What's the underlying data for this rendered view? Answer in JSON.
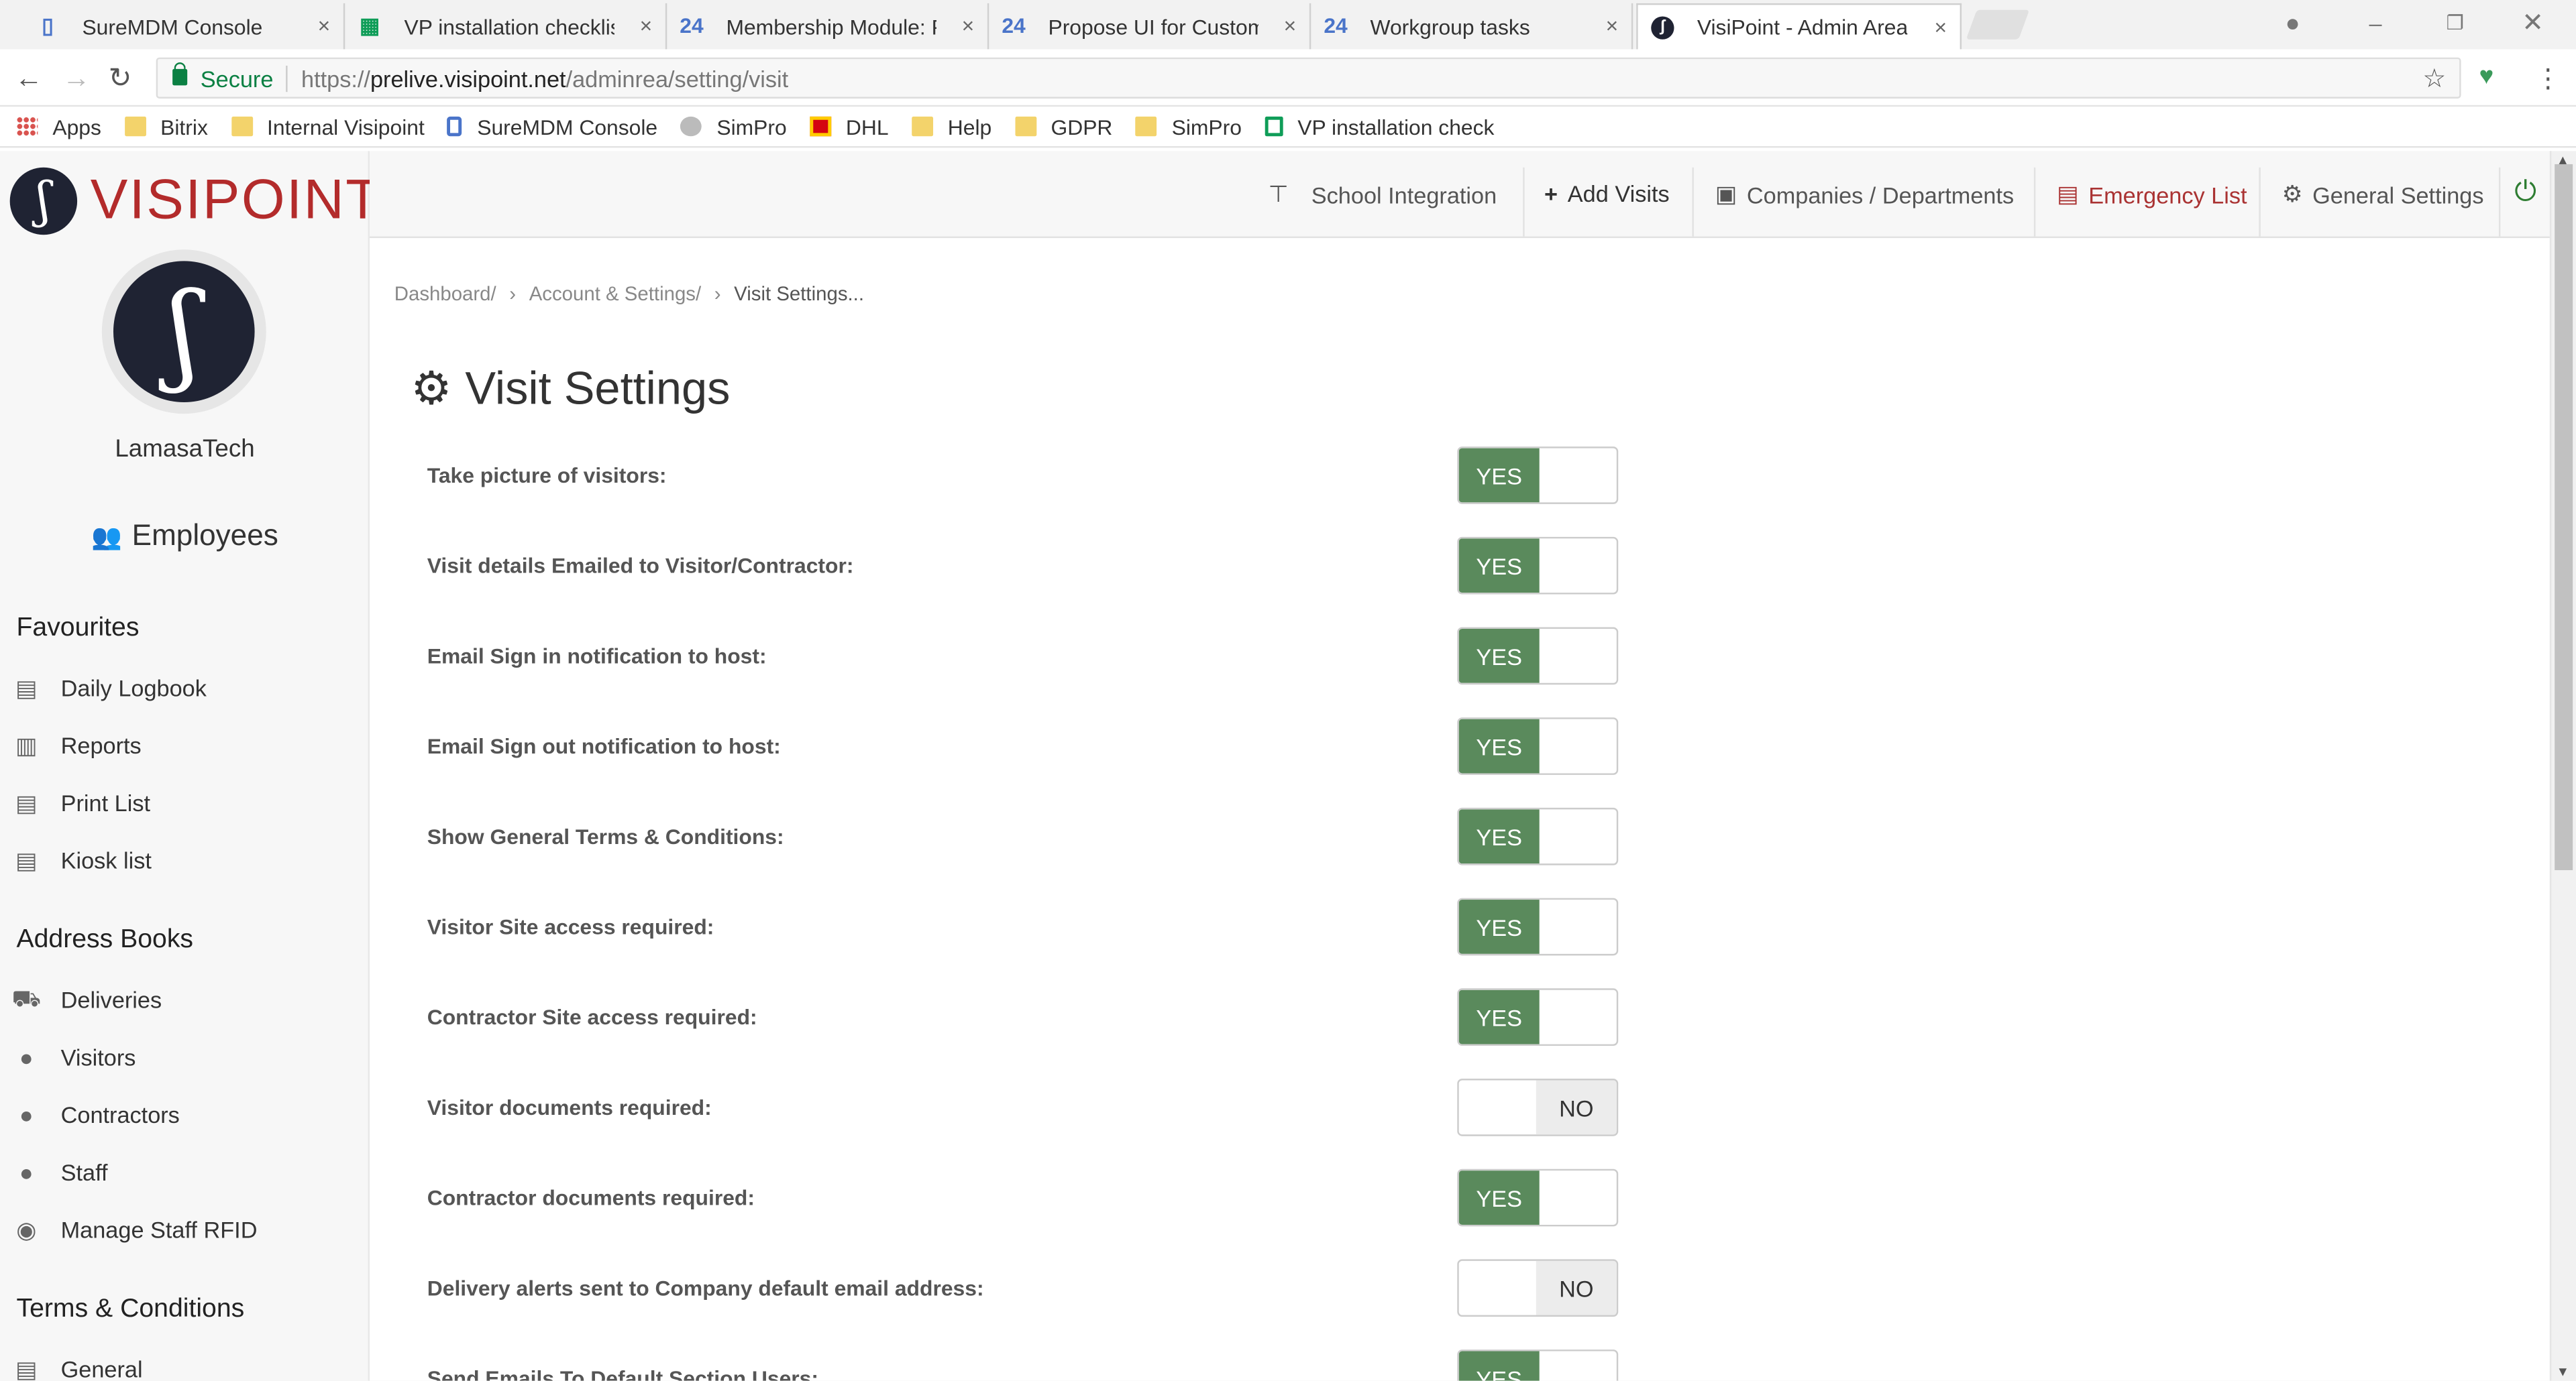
{
  "browser": {
    "tabs": [
      {
        "label": "SureMDM Console",
        "icon": "phone-icon"
      },
      {
        "label": "VP installation checklist -",
        "icon": "sheet-icon"
      },
      {
        "label": "Membership Module: PR",
        "icon": "24"
      },
      {
        "label": "Propose UI for Custom fi",
        "icon": "24"
      },
      {
        "label": "Workgroup tasks",
        "icon": "24"
      },
      {
        "label": "VisiPoint - Admin Area",
        "icon": "visipoint-icon"
      }
    ],
    "close_glyph": "×",
    "address": {
      "secure_label": "Secure",
      "url_scheme": "https://",
      "url_host": "prelive.visipoint.net",
      "url_path": "/adminrea/setting/visit"
    },
    "bookmarks": [
      "Apps",
      "Bitrix",
      "Internal Visipoint",
      "SureMDM Console",
      "SimPro",
      "DHL",
      "Help",
      "GDPR",
      "SimPro",
      "VP installation check"
    ]
  },
  "app": {
    "logo_text": "VISIPOINT",
    "company_name": "LamasaTech",
    "employees_label": "Employees",
    "favourites_heading": "Favourites",
    "favourites": [
      "Daily Logbook",
      "Reports",
      "Print List",
      "Kiosk list"
    ],
    "address_books_heading": "Address Books",
    "address_books": [
      "Deliveries",
      "Visitors",
      "Contractors",
      "Staff",
      "Manage Staff RFID"
    ],
    "terms_heading": "Terms & Conditions",
    "terms": [
      "General"
    ],
    "topnav": [
      "School Integration",
      "Add Visits",
      "Companies / Departments",
      "Emergency List",
      "General Settings"
    ],
    "breadcrumb": [
      "Dashboard/",
      "Account & Settings/",
      "Visit Settings..."
    ],
    "breadcrumb_sep": "›",
    "page_title": "Visit Settings",
    "settings": [
      {
        "label": "Take picture of visitors:",
        "value": "YES"
      },
      {
        "label": "Visit details Emailed to Visitor/Contractor:",
        "value": "YES"
      },
      {
        "label": "Email Sign in notification to host:",
        "value": "YES"
      },
      {
        "label": "Email Sign out notification to host:",
        "value": "YES"
      },
      {
        "label": "Show General Terms & Conditions:",
        "value": "YES"
      },
      {
        "label": "Visitor Site access required:",
        "value": "YES"
      },
      {
        "label": "Contractor Site access required:",
        "value": "YES"
      },
      {
        "label": "Visitor documents required:",
        "value": "NO"
      },
      {
        "label": "Contractor documents required:",
        "value": "YES"
      },
      {
        "label": "Delivery alerts sent to Company default email address:",
        "value": "NO"
      },
      {
        "label": "Send Emails To Default Section Users:",
        "value": "YES"
      }
    ]
  },
  "colors": {
    "brand_red": "#b32b2b",
    "toggle_green": "#5a8a5c",
    "emergency": "#a33333"
  }
}
